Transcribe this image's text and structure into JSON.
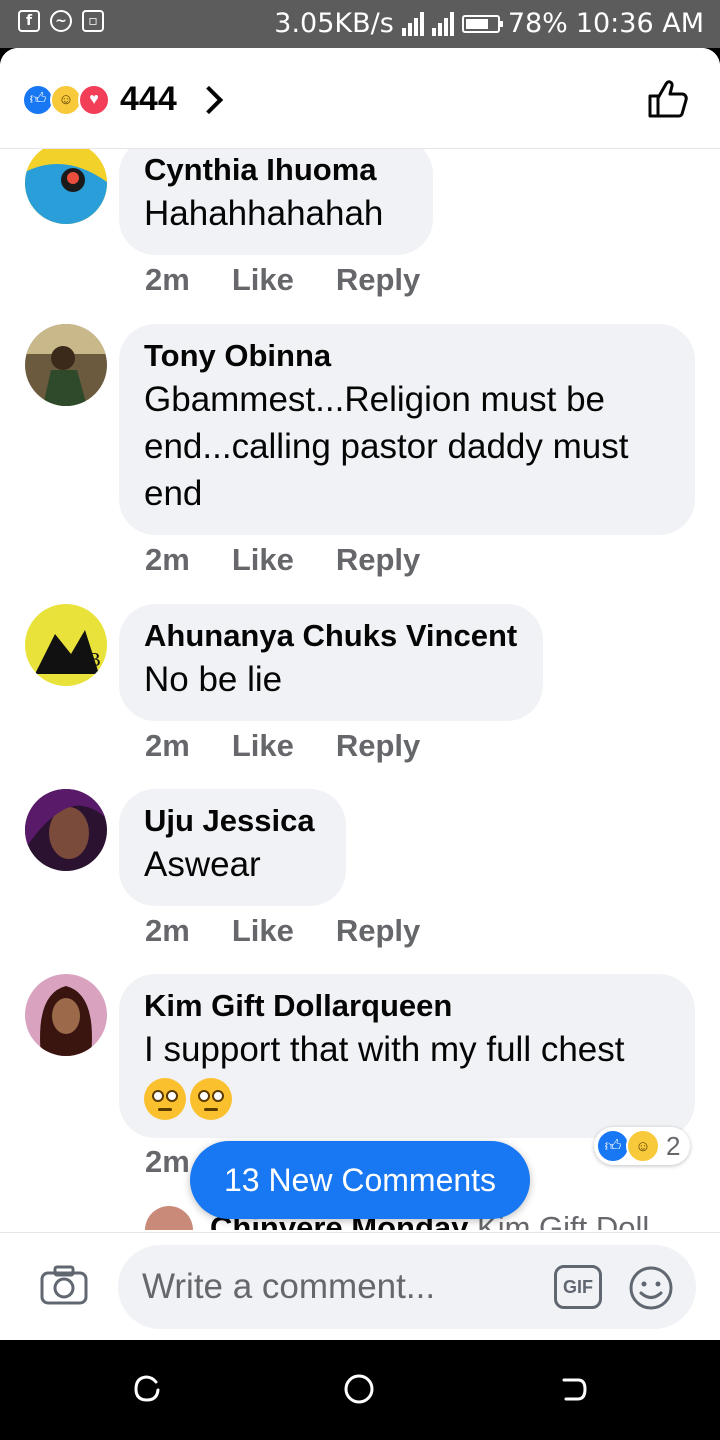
{
  "status_bar": {
    "net_speed": "3.05KB/s",
    "battery": "78%",
    "time": "10:36 AM"
  },
  "header": {
    "reaction_count": "444",
    "reactions": [
      "like-icon",
      "haha-icon",
      "love-icon"
    ]
  },
  "comments": [
    {
      "name": "Cynthia Ihuoma",
      "text": "Hahahhahahah",
      "time": "2m",
      "like": "Like",
      "reply": "Reply"
    },
    {
      "name": "Tony Obinna",
      "text": "Gbammest...Religion must be end...calling pastor daddy must end",
      "time": "2m",
      "like": "Like",
      "reply": "Reply"
    },
    {
      "name": "Ahunanya Chuks Vincent",
      "text": "No be lie",
      "time": "2m",
      "like": "Like",
      "reply": "Reply"
    },
    {
      "name": "Uju Jessica",
      "text": "Aswear",
      "time": "2m",
      "like": "Like",
      "reply": "Reply"
    },
    {
      "name": "Kim Gift Dollarqueen",
      "text": "I support that with my full chest",
      "time": "2m",
      "reaction_count": "2"
    }
  ],
  "peek_reply": {
    "name": "Chinyere Monday",
    "text": "Kim Gift Doll"
  },
  "new_comments_label": "13 New Comments",
  "composer": {
    "placeholder": "Write a comment...",
    "gif_label": "GIF"
  },
  "colors": {
    "accent": "#1877f2",
    "bubble": "#f0f2f5",
    "meta": "#65676b"
  }
}
